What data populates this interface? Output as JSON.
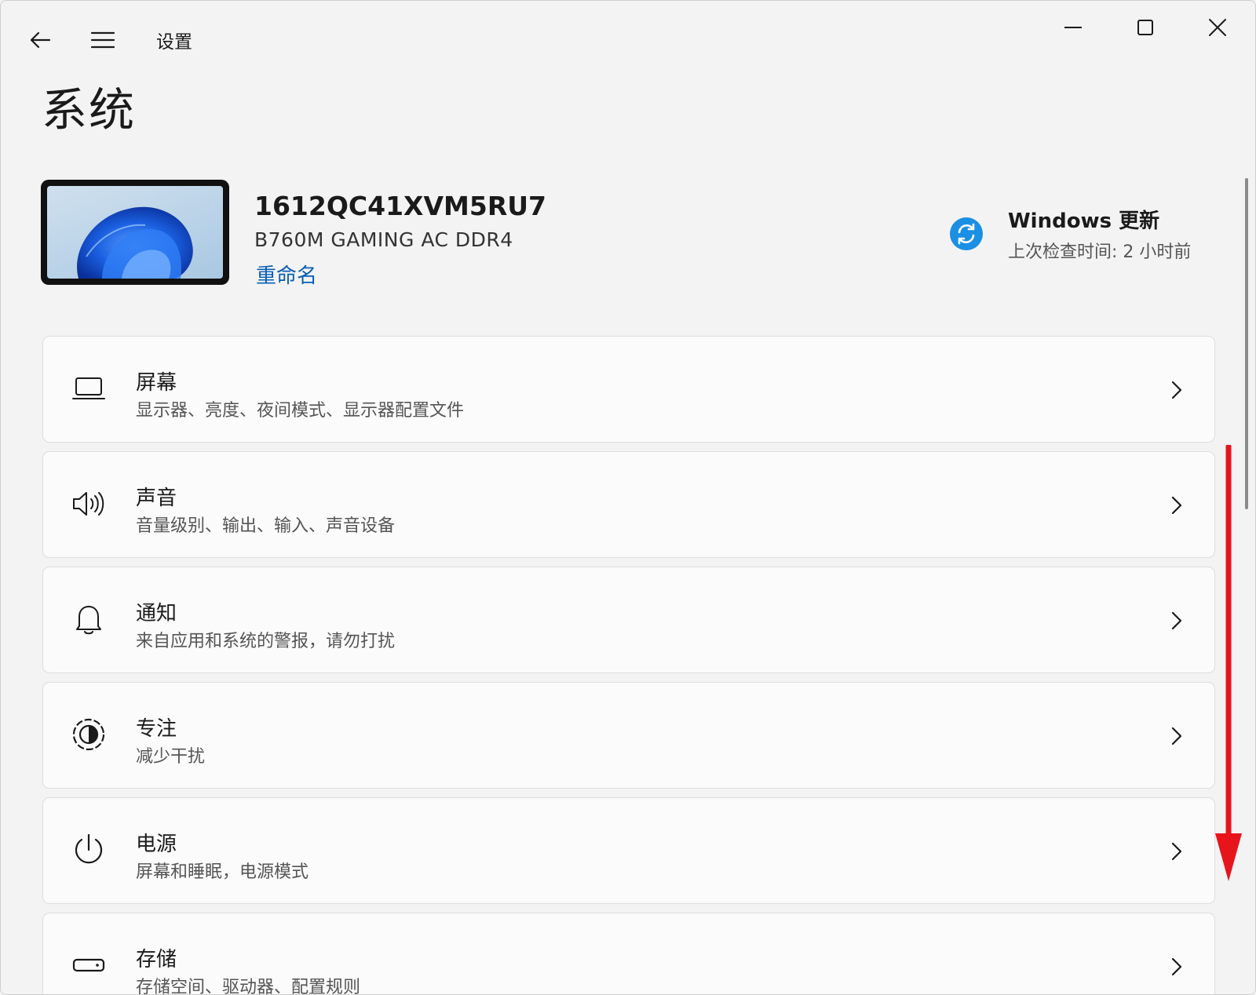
{
  "app": {
    "title": "设置",
    "page_title": "系统"
  },
  "device": {
    "name": "1612QC41XVM5RU7",
    "model": "B760M GAMING AC DDR4",
    "rename_label": "重命名"
  },
  "update": {
    "title": "Windows 更新",
    "subtitle": "上次检查时间: 2 小时前",
    "accent_color": "#1a8fe3"
  },
  "settings": [
    {
      "label": "屏幕",
      "desc": "显示器、亮度、夜间模式、显示器配置文件",
      "icon": "display-icon"
    },
    {
      "label": "声音",
      "desc": "音量级别、输出、输入、声音设备",
      "icon": "speaker-icon"
    },
    {
      "label": "通知",
      "desc": "来自应用和系统的警报，请勿打扰",
      "icon": "bell-icon"
    },
    {
      "label": "专注",
      "desc": "减少干扰",
      "icon": "focus-icon"
    },
    {
      "label": "电源",
      "desc": "屏幕和睡眠，电源模式",
      "icon": "power-icon"
    },
    {
      "label": "存储",
      "desc": "存储空间、驱动器、配置规则",
      "icon": "storage-icon"
    }
  ],
  "annotation": {
    "arrow_color": "#e8141c"
  }
}
